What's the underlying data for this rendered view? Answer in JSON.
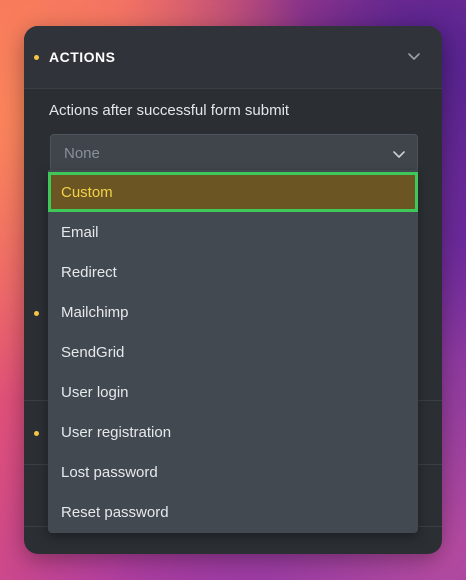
{
  "section": {
    "title": "ACTIONS"
  },
  "actions_label": "Actions after successful form submit",
  "select": {
    "value": "None"
  },
  "dropdown": {
    "options": [
      "Custom",
      "Email",
      "Redirect",
      "Mailchimp",
      "SendGrid",
      "User login",
      "User registration",
      "Lost password",
      "Reset password"
    ],
    "highlighted": "Custom"
  },
  "colors": {
    "panel": "#2b2f34",
    "dropdown": "#434950",
    "highlight_bg": "#6a5523",
    "highlight_border": "#3ec85a",
    "highlight_text": "#f3d24a",
    "accent_dot": "#f5c542"
  },
  "icons": {
    "section_toggle": "chevron-down-icon",
    "select_toggle": "chevron-down-icon"
  }
}
